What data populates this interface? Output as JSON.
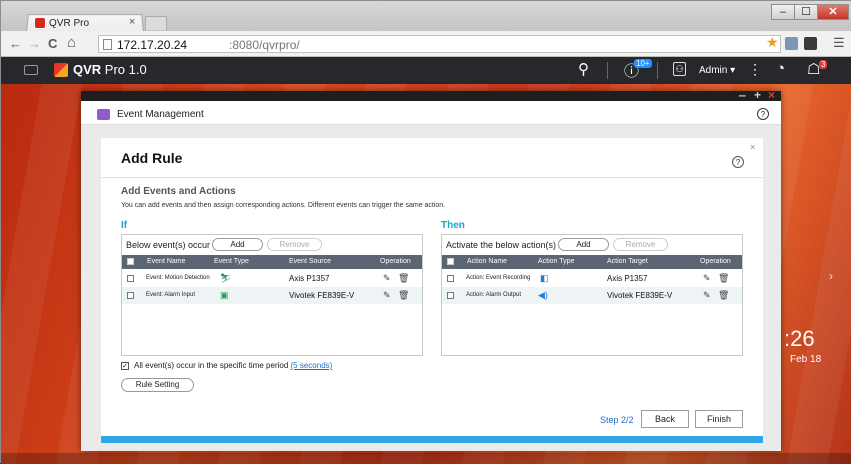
{
  "browser": {
    "tab_title": "QVR Pro",
    "tab_close": "×",
    "window_min": "‒",
    "window_max": "☐",
    "window_close": "✕",
    "back_icon": "←",
    "forward_icon": "→",
    "reload_icon": "C",
    "home_icon": "⌂",
    "url_host": "172.17.20.24",
    "url_rest": ":8080/qvrpro/",
    "star_icon": "★",
    "menu_icon": "☰",
    "ext_colors": [
      "#7f95b8",
      "#3a3a3a"
    ]
  },
  "appbar": {
    "title_bold": "QVR",
    "title_rest": " Pro 1.0",
    "search_icon": "⚲",
    "notif_badge": "10+",
    "admin_label": "Admin ▾",
    "more_icon": "⋮",
    "alert_badge": "3",
    "info_icon": "ⓘ",
    "user_icon": "⚇",
    "dashboard_icon": "◔",
    "bell_icon": "☖"
  },
  "em_window": {
    "title": "Event Management",
    "help": "?",
    "ctl_min": "‒",
    "ctl_max": "+",
    "ctl_close": "×"
  },
  "dialog": {
    "title": "Add Rule",
    "help": "?",
    "close": "×",
    "section_title": "Add Events and Actions",
    "section_desc": "You can add events and then assign corresponding actions. Different events can trigger the same action.",
    "if_label": "If",
    "then_label": "Then",
    "events": {
      "label": "Below event(s) occur",
      "add": "Add",
      "remove": "Remove",
      "columns": [
        "Event Name",
        "Event Type",
        "Event Source",
        "Operation"
      ],
      "rows": [
        {
          "name": "Event: Motion Detection",
          "type_icon": "⛷",
          "type_color": "#2a9a57",
          "source": "Axis P1357"
        },
        {
          "name": "Event: Alarm Input",
          "type_icon": "▣",
          "type_color": "#2a9a57",
          "source": "Vivotek FE839E-V"
        }
      ]
    },
    "actions": {
      "label": "Activate the below action(s)",
      "add": "Add",
      "remove": "Remove",
      "columns": [
        "Action Name",
        "Action Type",
        "Action Target",
        "Operation"
      ],
      "rows": [
        {
          "name": "Action: Event Recording",
          "type_icon": "◧",
          "type_color": "#1b7fd6",
          "source": "Axis P1357"
        },
        {
          "name": "Action: Alarm Output",
          "type_icon": "◀)",
          "type_color": "#1b7fd6",
          "source": "Vivotek FE839E-V"
        }
      ]
    },
    "edit_icon": "✎",
    "delete_icon": "🗑",
    "time_check": "✓",
    "time_text": "All event(s) occur in the specific time period ",
    "time_link": "(5 seconds)",
    "rule_setting": "Rule Setting",
    "step": "Step 2/2",
    "back": "Back",
    "finish": "Finish"
  },
  "desktop": {
    "clock": ":26",
    "date": "Feb 18",
    "chevron": "›"
  }
}
